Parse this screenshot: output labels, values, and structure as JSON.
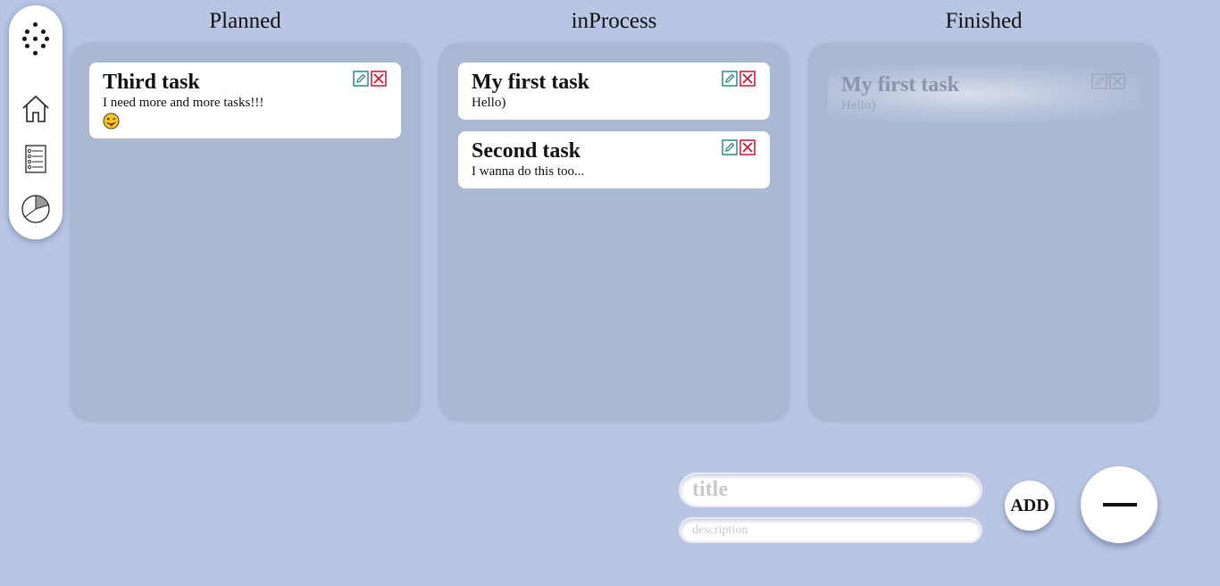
{
  "sidebar": {
    "menu_icon": "grid-dots-icon",
    "items": [
      {
        "name": "home",
        "icon": "home-icon"
      },
      {
        "name": "list",
        "icon": "checklist-icon"
      },
      {
        "name": "stats",
        "icon": "pie-chart-icon"
      }
    ]
  },
  "columns": [
    {
      "title": "Planned",
      "cards": [
        {
          "title": "Third task",
          "description": "I need more and more tasks!!!",
          "emoji": "tongue-out-emoji",
          "finished": false
        }
      ]
    },
    {
      "title": "inProcess",
      "cards": [
        {
          "title": "My first task",
          "description": "Hello)",
          "finished": false
        },
        {
          "title": "Second task",
          "description": "I wanna do this too...",
          "finished": false
        }
      ]
    },
    {
      "title": "Finished",
      "cards": [
        {
          "title": "My first task",
          "description": "Hello)",
          "finished": true
        }
      ]
    }
  ],
  "form": {
    "title_placeholder": "title",
    "description_placeholder": "description",
    "add_label": "ADD"
  },
  "colors": {
    "background": "#b8c6e4",
    "board": "#aab8d4",
    "edit_icon": "#2a8a86",
    "delete_icon": "#c8102e"
  }
}
